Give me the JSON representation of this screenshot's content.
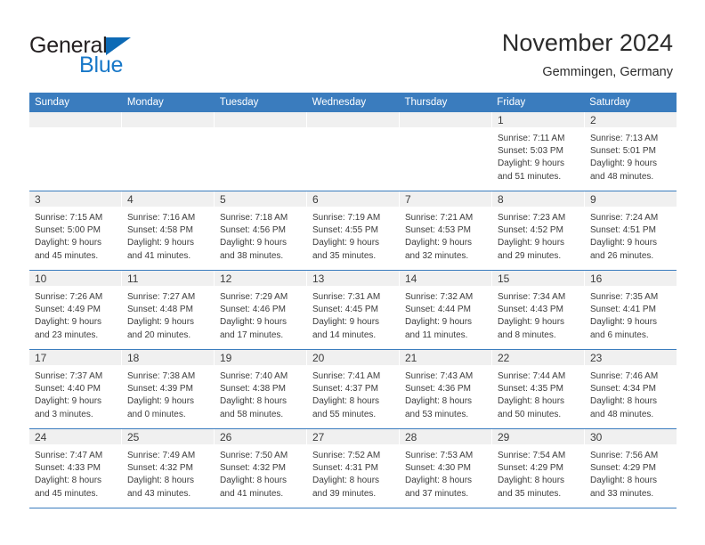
{
  "brand": {
    "name_top": "General",
    "name_bottom": "Blue",
    "triangle_icon": "triangle-icon",
    "primary_color": "#1878c8",
    "text_color": "#231f20"
  },
  "header": {
    "month_title": "November 2024",
    "location": "Gemmingen, Germany"
  },
  "calendar": {
    "header_bg": "#3a7cbe",
    "header_text_color": "#ffffff",
    "row_separator_color": "#3a7cbe",
    "day_band_bg": "#f0f0f0",
    "weekdays": [
      "Sunday",
      "Monday",
      "Tuesday",
      "Wednesday",
      "Thursday",
      "Friday",
      "Saturday"
    ],
    "weeks": [
      [
        {
          "day": "",
          "sunrise": "",
          "sunset": "",
          "daylight_line1": "",
          "daylight_line2": ""
        },
        {
          "day": "",
          "sunrise": "",
          "sunset": "",
          "daylight_line1": "",
          "daylight_line2": ""
        },
        {
          "day": "",
          "sunrise": "",
          "sunset": "",
          "daylight_line1": "",
          "daylight_line2": ""
        },
        {
          "day": "",
          "sunrise": "",
          "sunset": "",
          "daylight_line1": "",
          "daylight_line2": ""
        },
        {
          "day": "",
          "sunrise": "",
          "sunset": "",
          "daylight_line1": "",
          "daylight_line2": ""
        },
        {
          "day": "1",
          "sunrise": "Sunrise: 7:11 AM",
          "sunset": "Sunset: 5:03 PM",
          "daylight_line1": "Daylight: 9 hours",
          "daylight_line2": "and 51 minutes."
        },
        {
          "day": "2",
          "sunrise": "Sunrise: 7:13 AM",
          "sunset": "Sunset: 5:01 PM",
          "daylight_line1": "Daylight: 9 hours",
          "daylight_line2": "and 48 minutes."
        }
      ],
      [
        {
          "day": "3",
          "sunrise": "Sunrise: 7:15 AM",
          "sunset": "Sunset: 5:00 PM",
          "daylight_line1": "Daylight: 9 hours",
          "daylight_line2": "and 45 minutes."
        },
        {
          "day": "4",
          "sunrise": "Sunrise: 7:16 AM",
          "sunset": "Sunset: 4:58 PM",
          "daylight_line1": "Daylight: 9 hours",
          "daylight_line2": "and 41 minutes."
        },
        {
          "day": "5",
          "sunrise": "Sunrise: 7:18 AM",
          "sunset": "Sunset: 4:56 PM",
          "daylight_line1": "Daylight: 9 hours",
          "daylight_line2": "and 38 minutes."
        },
        {
          "day": "6",
          "sunrise": "Sunrise: 7:19 AM",
          "sunset": "Sunset: 4:55 PM",
          "daylight_line1": "Daylight: 9 hours",
          "daylight_line2": "and 35 minutes."
        },
        {
          "day": "7",
          "sunrise": "Sunrise: 7:21 AM",
          "sunset": "Sunset: 4:53 PM",
          "daylight_line1": "Daylight: 9 hours",
          "daylight_line2": "and 32 minutes."
        },
        {
          "day": "8",
          "sunrise": "Sunrise: 7:23 AM",
          "sunset": "Sunset: 4:52 PM",
          "daylight_line1": "Daylight: 9 hours",
          "daylight_line2": "and 29 minutes."
        },
        {
          "day": "9",
          "sunrise": "Sunrise: 7:24 AM",
          "sunset": "Sunset: 4:51 PM",
          "daylight_line1": "Daylight: 9 hours",
          "daylight_line2": "and 26 minutes."
        }
      ],
      [
        {
          "day": "10",
          "sunrise": "Sunrise: 7:26 AM",
          "sunset": "Sunset: 4:49 PM",
          "daylight_line1": "Daylight: 9 hours",
          "daylight_line2": "and 23 minutes."
        },
        {
          "day": "11",
          "sunrise": "Sunrise: 7:27 AM",
          "sunset": "Sunset: 4:48 PM",
          "daylight_line1": "Daylight: 9 hours",
          "daylight_line2": "and 20 minutes."
        },
        {
          "day": "12",
          "sunrise": "Sunrise: 7:29 AM",
          "sunset": "Sunset: 4:46 PM",
          "daylight_line1": "Daylight: 9 hours",
          "daylight_line2": "and 17 minutes."
        },
        {
          "day": "13",
          "sunrise": "Sunrise: 7:31 AM",
          "sunset": "Sunset: 4:45 PM",
          "daylight_line1": "Daylight: 9 hours",
          "daylight_line2": "and 14 minutes."
        },
        {
          "day": "14",
          "sunrise": "Sunrise: 7:32 AM",
          "sunset": "Sunset: 4:44 PM",
          "daylight_line1": "Daylight: 9 hours",
          "daylight_line2": "and 11 minutes."
        },
        {
          "day": "15",
          "sunrise": "Sunrise: 7:34 AM",
          "sunset": "Sunset: 4:43 PM",
          "daylight_line1": "Daylight: 9 hours",
          "daylight_line2": "and 8 minutes."
        },
        {
          "day": "16",
          "sunrise": "Sunrise: 7:35 AM",
          "sunset": "Sunset: 4:41 PM",
          "daylight_line1": "Daylight: 9 hours",
          "daylight_line2": "and 6 minutes."
        }
      ],
      [
        {
          "day": "17",
          "sunrise": "Sunrise: 7:37 AM",
          "sunset": "Sunset: 4:40 PM",
          "daylight_line1": "Daylight: 9 hours",
          "daylight_line2": "and 3 minutes."
        },
        {
          "day": "18",
          "sunrise": "Sunrise: 7:38 AM",
          "sunset": "Sunset: 4:39 PM",
          "daylight_line1": "Daylight: 9 hours",
          "daylight_line2": "and 0 minutes."
        },
        {
          "day": "19",
          "sunrise": "Sunrise: 7:40 AM",
          "sunset": "Sunset: 4:38 PM",
          "daylight_line1": "Daylight: 8 hours",
          "daylight_line2": "and 58 minutes."
        },
        {
          "day": "20",
          "sunrise": "Sunrise: 7:41 AM",
          "sunset": "Sunset: 4:37 PM",
          "daylight_line1": "Daylight: 8 hours",
          "daylight_line2": "and 55 minutes."
        },
        {
          "day": "21",
          "sunrise": "Sunrise: 7:43 AM",
          "sunset": "Sunset: 4:36 PM",
          "daylight_line1": "Daylight: 8 hours",
          "daylight_line2": "and 53 minutes."
        },
        {
          "day": "22",
          "sunrise": "Sunrise: 7:44 AM",
          "sunset": "Sunset: 4:35 PM",
          "daylight_line1": "Daylight: 8 hours",
          "daylight_line2": "and 50 minutes."
        },
        {
          "day": "23",
          "sunrise": "Sunrise: 7:46 AM",
          "sunset": "Sunset: 4:34 PM",
          "daylight_line1": "Daylight: 8 hours",
          "daylight_line2": "and 48 minutes."
        }
      ],
      [
        {
          "day": "24",
          "sunrise": "Sunrise: 7:47 AM",
          "sunset": "Sunset: 4:33 PM",
          "daylight_line1": "Daylight: 8 hours",
          "daylight_line2": "and 45 minutes."
        },
        {
          "day": "25",
          "sunrise": "Sunrise: 7:49 AM",
          "sunset": "Sunset: 4:32 PM",
          "daylight_line1": "Daylight: 8 hours",
          "daylight_line2": "and 43 minutes."
        },
        {
          "day": "26",
          "sunrise": "Sunrise: 7:50 AM",
          "sunset": "Sunset: 4:32 PM",
          "daylight_line1": "Daylight: 8 hours",
          "daylight_line2": "and 41 minutes."
        },
        {
          "day": "27",
          "sunrise": "Sunrise: 7:52 AM",
          "sunset": "Sunset: 4:31 PM",
          "daylight_line1": "Daylight: 8 hours",
          "daylight_line2": "and 39 minutes."
        },
        {
          "day": "28",
          "sunrise": "Sunrise: 7:53 AM",
          "sunset": "Sunset: 4:30 PM",
          "daylight_line1": "Daylight: 8 hours",
          "daylight_line2": "and 37 minutes."
        },
        {
          "day": "29",
          "sunrise": "Sunrise: 7:54 AM",
          "sunset": "Sunset: 4:29 PM",
          "daylight_line1": "Daylight: 8 hours",
          "daylight_line2": "and 35 minutes."
        },
        {
          "day": "30",
          "sunrise": "Sunrise: 7:56 AM",
          "sunset": "Sunset: 4:29 PM",
          "daylight_line1": "Daylight: 8 hours",
          "daylight_line2": "and 33 minutes."
        }
      ]
    ]
  }
}
